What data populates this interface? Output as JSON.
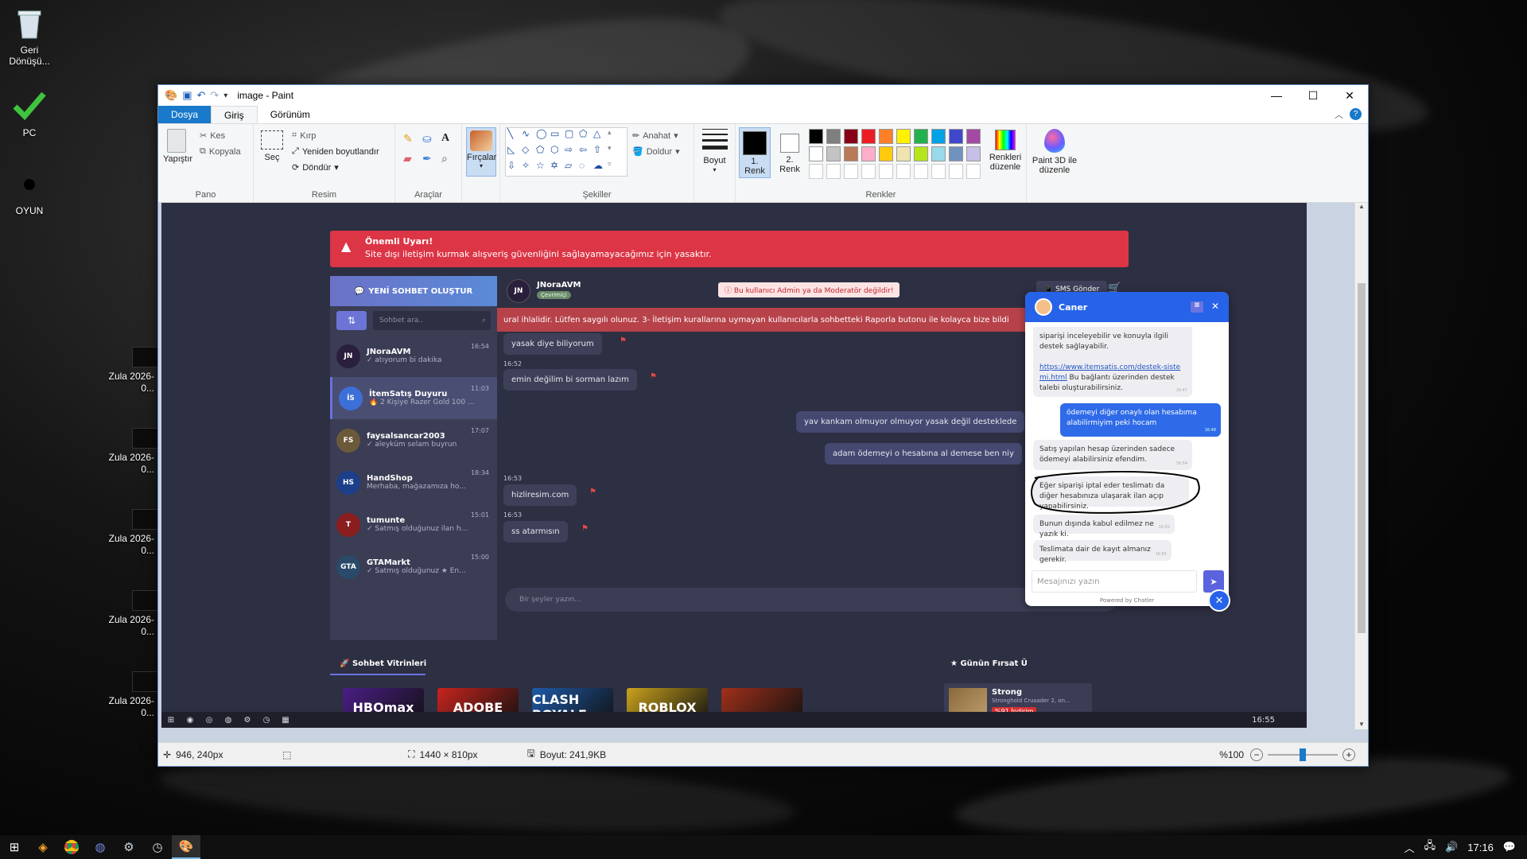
{
  "desktop": {
    "icons": [
      {
        "label": "Geri Dönüşü..."
      },
      {
        "label": "PC"
      },
      {
        "label": "OYUN"
      }
    ],
    "thumbs": [
      {
        "label": "Zula 2026-0..."
      },
      {
        "label": "Zula 2026-0..."
      },
      {
        "label": "Zula 2026-0..."
      },
      {
        "label": "Zula 2026-0..."
      },
      {
        "label": "Zula 2026-0..."
      }
    ]
  },
  "paint": {
    "title": "image - Paint",
    "tabs": {
      "file": "Dosya",
      "home": "Giriş",
      "view": "Görünüm"
    },
    "clipboard": {
      "paste": "Yapıştır",
      "cut": "Kes",
      "copy": "Kopyala",
      "group": "Pano"
    },
    "image": {
      "select": "Seç",
      "crop": "Kırp",
      "resize": "Yeniden boyutlandır",
      "rotate": "Döndür",
      "group": "Resim"
    },
    "tools": {
      "group": "Araçlar"
    },
    "brushes": {
      "label": "Fırçalar"
    },
    "shapes": {
      "outline": "Anahat",
      "fill": "Doldur",
      "group": "Şekiller"
    },
    "size": {
      "label": "Boyut"
    },
    "color1": {
      "label": "1. Renk"
    },
    "color2": {
      "label": "2. Renk"
    },
    "colors": {
      "edit": "Renkleri düzenle",
      "group": "Renkler"
    },
    "paint3d": {
      "label": "Paint 3D ile düzenle"
    },
    "status": {
      "cursor": "946, 240px",
      "dimensions": "1440 × 810px",
      "size": "Boyut: 241,9KB",
      "zoom": "%100"
    }
  },
  "shot": {
    "alert_title": "Önemli Uyarı!",
    "alert_text": "Site dışı iletişim kurmak alışveriş güvenliğini sağlayamayacağımız için yasaktır.",
    "new_chat": "YENİ SOHBET OLUŞTUR",
    "search_placeholder": "Sohbet ara..",
    "contacts": [
      {
        "name": "JNoraAVM",
        "time": "16:54",
        "msg": "✓ atıyorum bi dakika",
        "color": "#2a1f3d",
        "initials": "JN"
      },
      {
        "name": "İtemSatış Duyuru",
        "time": "11:03",
        "msg": "🔥 2 Kişiye Razer Gold 100 ...",
        "color": "#3d6fd8",
        "initials": "İS"
      },
      {
        "name": "faysalsancar2003",
        "time": "17:07",
        "msg": "✓ aleyküm selam buyrun",
        "color": "#6b5a3a",
        "initials": "FS"
      },
      {
        "name": "HandShop",
        "time": "18:34",
        "msg": "Merhaba, mağazamıza ho...",
        "color": "#1d3f8a",
        "initials": "HS"
      },
      {
        "name": "tumunte",
        "time": "15:01",
        "msg": "✓ Satmış olduğunuz ilan h...",
        "color": "#8a1d1d",
        "initials": "T"
      },
      {
        "name": "GTAMarkt",
        "time": "15:00",
        "msg": "✓ Satmış olduğunuz ★ En...",
        "color": "#2a4a6a",
        "initials": "GTA"
      }
    ],
    "chat_name": "JNoraAVM",
    "chat_status": "Çevrimiçi",
    "warn_badge": "Bu kullanıcı Admin ya da Moderatör değildir!",
    "sms_button": "SMS Gönder",
    "banner": "ural ihlalidir. Lütfen saygılı olunuz. 3- İletişim kurallarına uymayan kullanıcılarla sohbetteki Raporla butonu ile kolayca bize bildi",
    "messages": [
      {
        "text": "yasak diye biliyorum",
        "time": ""
      },
      {
        "text": "emin değilim bi sorman lazım",
        "time": "16:52"
      },
      {
        "text": "yav kankam olmuyor olmuyor yasak değil desteklede",
        "time": ""
      },
      {
        "text": "adam ödemeyi o hesabına al demese ben niy",
        "time": ""
      },
      {
        "text": "hizliresim.com",
        "time": "16:53"
      },
      {
        "text": "ss atarmısın",
        "time": "16:53"
      }
    ],
    "input_placeholder": "Bir şeyler yazın...",
    "showcase_title": "Sohbet Vitrinleri",
    "deal_title": "Günün Fırsat Ü",
    "products": [
      {
        "name": "HBOmax",
        "color": "#4b1e86"
      },
      {
        "name": "ADOBE",
        "color": "#c8241e"
      },
      {
        "name": "CLASH ROYALE",
        "color": "#1e5aa8"
      },
      {
        "name": "ROBLOX",
        "color": "#c9a21c"
      },
      {
        "name": "",
        "color": "#a0301a"
      }
    ],
    "deal_product": {
      "name": "Strong",
      "subtitle": "Stronghold Crusader 2, on...",
      "discount": "%91 İndirim"
    },
    "inner_clock": "16:55"
  },
  "widget": {
    "agent": "Caner",
    "messages": [
      {
        "text": "siparişi inceleyebilir ve konuyla ilgili destek sağlayabilir.",
        "link": "https://www.itemsatis.com/destek-sistemi.html",
        "after": "Bu bağlantı üzerinden destek talebi oluşturabilirsiniz.",
        "time": "16:47"
      },
      {
        "text": "ödemeyi diğer onaylı olan hesabıma alabilirmiyim peki hocam",
        "time": "16:48"
      },
      {
        "text": "Satış yapılan hesap üzerinden sadece ödemeyi alabilirsiniz efendim.",
        "time": "16:54"
      },
      {
        "text": "Eğer siparişi iptal eder teslimatı da diğer hesabınıza ulaşarak ilan açıp yapabilirsiniz.",
        "time": ""
      },
      {
        "text": "Bunun dışında kabul edilmez ne yazık ki.",
        "time": "16:55"
      },
      {
        "text": "Teslimata dair de kayıt almanız gerekir.",
        "time": "16:55"
      }
    ],
    "input_placeholder": "Mesajınızı yazın",
    "powered": "Powered by Chatler"
  },
  "taskbar": {
    "time": "17:16"
  }
}
